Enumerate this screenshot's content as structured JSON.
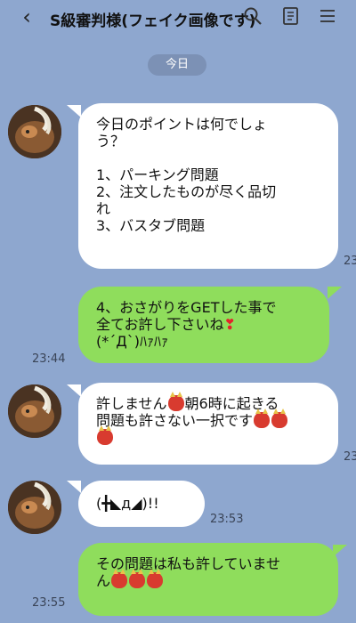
{
  "header": {
    "back_glyph": "‹",
    "title": "S級審判様(フェイク画像です)"
  },
  "date_label": "今日",
  "messages": [
    {
      "text": "今日のポイントは何でしょ\nう？\n\n1、パーキング問題\n2、注文したものが尽く品切\nれ\n3、バスタブ問題",
      "time": "23:"
    },
    {
      "text_a": "4、おさがりをGETした事で\n全てお許し下さいね",
      "heart": "❣",
      "text_b": "\n(*´Д`)ﾊｧﾊｧ",
      "time": "23:44"
    },
    {
      "text_a": "許しません",
      "text_b": "朝6時に起きる\n問題も許さない一択です",
      "time": "23:"
    },
    {
      "text": "(╋◣д◢)!!",
      "time": "23:53"
    },
    {
      "text": "その問題は私も許していませ\nん",
      "time": "23:55"
    }
  ],
  "colors": {
    "background": "#8ea7cf",
    "incoming_bubble": "#ffffff",
    "outgoing_bubble": "#8fdd5c"
  }
}
